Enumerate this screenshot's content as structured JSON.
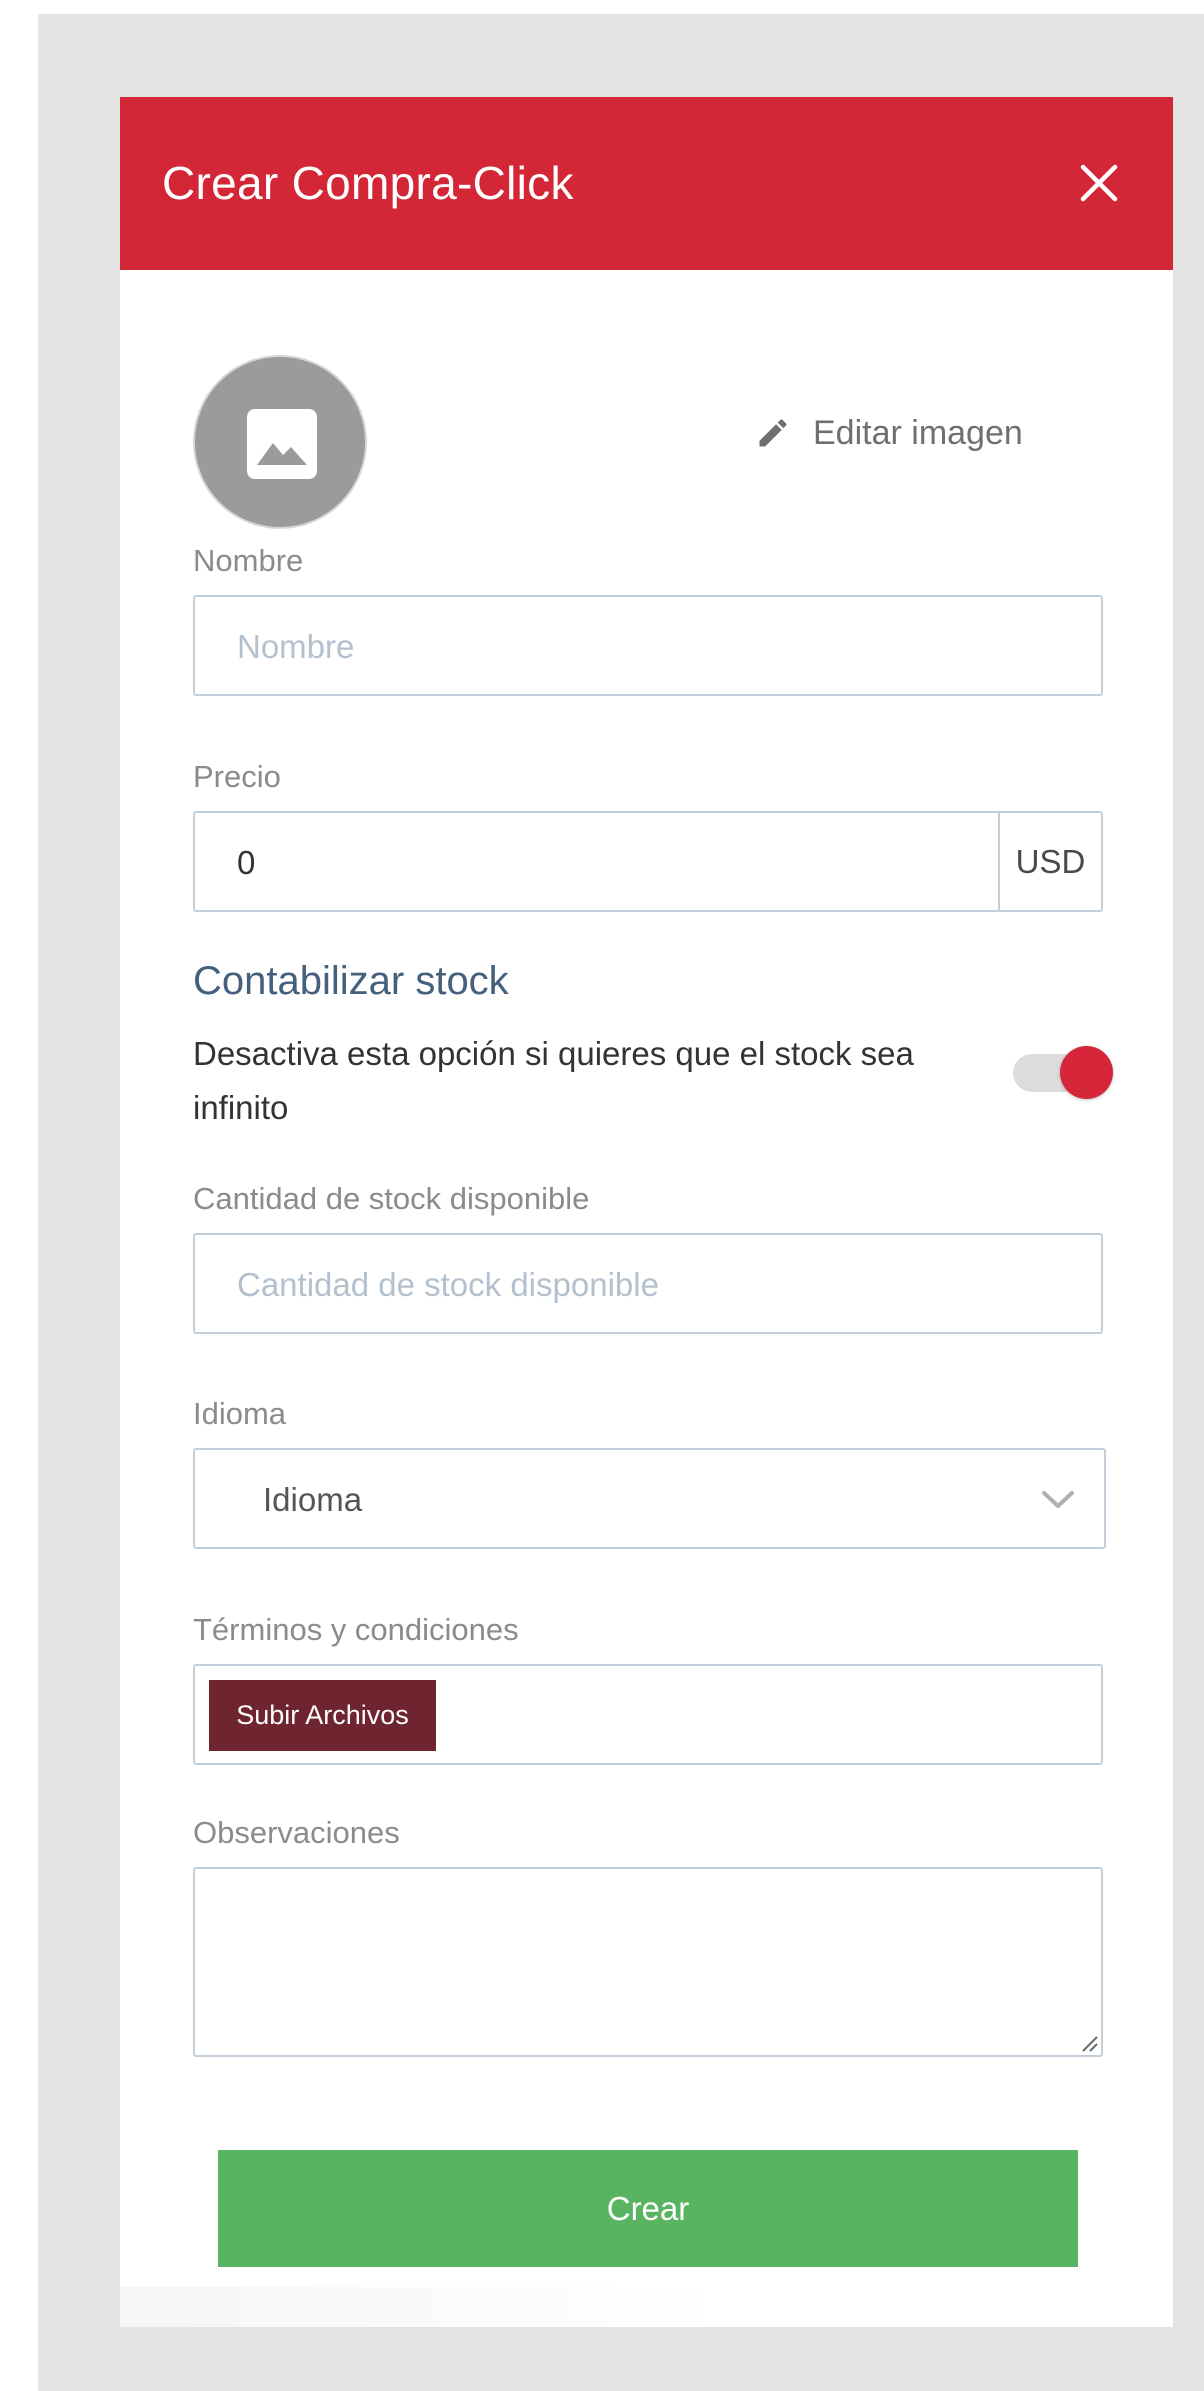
{
  "modal": {
    "title": "Crear Compra-Click"
  },
  "image": {
    "edit_label": "Editar imagen"
  },
  "form": {
    "name": {
      "label": "Nombre",
      "placeholder": "Nombre",
      "value": ""
    },
    "price": {
      "label": "Precio",
      "value": "0",
      "currency": "USD"
    },
    "stock": {
      "title": "Contabilizar stock",
      "description": "Desactiva esta opción si quieres que el stock sea infinito",
      "enabled": true
    },
    "stock_qty": {
      "label": "Cantidad de stock disponible",
      "placeholder": "Cantidad de stock disponible"
    },
    "language": {
      "label": "Idioma",
      "selected": "Idioma"
    },
    "terms": {
      "label": "Términos y condiciones",
      "upload_label": "Subir Archivos"
    },
    "notes": {
      "label": "Observaciones",
      "value": ""
    },
    "submit_label": "Crear"
  },
  "colors": {
    "header": "#d32636",
    "toggle_on": "#d6263a",
    "upload": "#6e2530",
    "submit": "#59b462",
    "section_title": "#44607c"
  },
  "icons": {
    "close": "close-icon",
    "image_placeholder": "image-icon",
    "edit": "pencil-icon",
    "select": "chevron-down-icon",
    "resize": "resize-handle-icon"
  }
}
